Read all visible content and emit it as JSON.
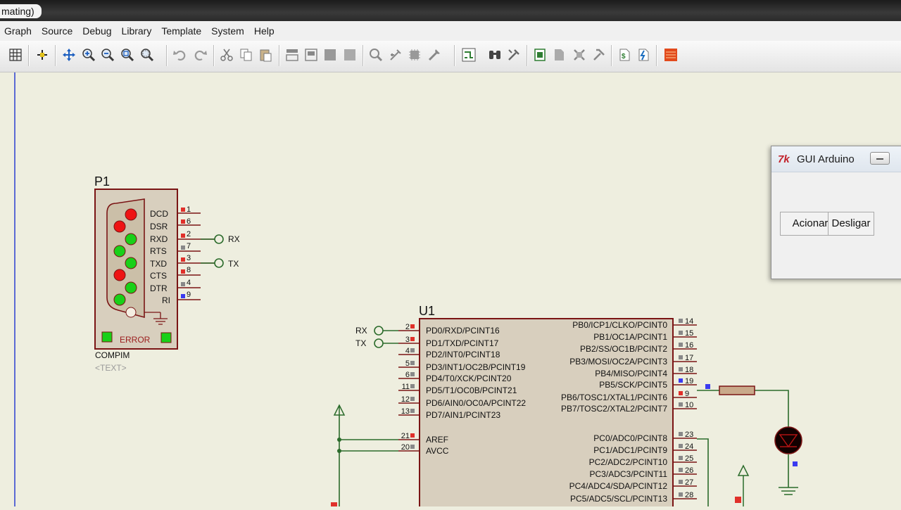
{
  "window": {
    "title_fragment": "mating)"
  },
  "menu": [
    "Graph",
    "Source",
    "Debug",
    "Library",
    "Template",
    "System",
    "Help"
  ],
  "toolbar_icons": [
    "grid-icon",
    "origin-icon",
    "pan-icon",
    "zoom-in-icon",
    "zoom-out-icon",
    "zoom-all-icon",
    "zoom-area-icon",
    "undo-icon",
    "redo-icon",
    "cut-icon",
    "copy-icon",
    "paste-icon",
    "block-copy-icon",
    "block-move-icon",
    "block-rotate-icon",
    "block-delete-icon",
    "pick-device-icon",
    "make-device-icon",
    "packaging-icon",
    "decompose-icon",
    "wire-autorouter-icon",
    "search-tag-icon",
    "property-assign-icon",
    "new-sheet-icon",
    "remove-sheet-icon",
    "exit-to-parent-icon",
    "goto-sheet-icon",
    "bill-of-materials-icon",
    "electrical-check-icon",
    "ares-icon"
  ],
  "compim": {
    "ref": "P1",
    "part": "COMPIM",
    "text_placeholder": "<TEXT>",
    "status": "ERROR",
    "signals": [
      "DCD",
      "DSR",
      "RXD",
      "RTS",
      "TXD",
      "CTS",
      "DTR",
      "RI"
    ],
    "pins": [
      "1",
      "6",
      "2",
      "7",
      "3",
      "8",
      "4",
      "9"
    ],
    "terminals": [
      "RX",
      "TX"
    ]
  },
  "mcu": {
    "ref": "U1",
    "left_pins": [
      {
        "num": "2",
        "name": "PD0/RXD/PCINT16"
      },
      {
        "num": "3",
        "name": "PD1/TXD/PCINT17"
      },
      {
        "num": "4",
        "name": "PD2/INT0/PCINT18"
      },
      {
        "num": "5",
        "name": "PD3/INT1/OC2B/PCINT19"
      },
      {
        "num": "6",
        "name": "PD4/T0/XCK/PCINT20"
      },
      {
        "num": "11",
        "name": "PD5/T1/OC0B/PCINT21"
      },
      {
        "num": "12",
        "name": "PD6/AIN0/OC0A/PCINT22"
      },
      {
        "num": "13",
        "name": "PD7/AIN1/PCINT23"
      },
      {
        "num": "21",
        "name": "AREF"
      },
      {
        "num": "20",
        "name": "AVCC"
      }
    ],
    "right_pins": [
      {
        "num": "14",
        "name": "PB0/ICP1/CLKO/PCINT0"
      },
      {
        "num": "15",
        "name": "PB1/OC1A/PCINT1"
      },
      {
        "num": "16",
        "name": "PB2/SS/OC1B/PCINT2"
      },
      {
        "num": "17",
        "name": "PB3/MOSI/OC2A/PCINT3"
      },
      {
        "num": "18",
        "name": "PB4/MISO/PCINT4"
      },
      {
        "num": "19",
        "name": "PB5/SCK/PCINT5"
      },
      {
        "num": "9",
        "name": "PB6/TOSC1/XTAL1/PCINT6"
      },
      {
        "num": "10",
        "name": "PB7/TOSC2/XTAL2/PCINT7"
      },
      {
        "num": "23",
        "name": "PC0/ADC0/PCINT8"
      },
      {
        "num": "24",
        "name": "PC1/ADC1/PCINT9"
      },
      {
        "num": "25",
        "name": "PC2/ADC2/PCINT10"
      },
      {
        "num": "26",
        "name": "PC3/ADC3/PCINT11"
      },
      {
        "num": "27",
        "name": "PC4/ADC4/SDA/PCINT12"
      },
      {
        "num": "28",
        "name": "PC5/ADC5/SCL/PCINT13"
      }
    ],
    "terminals": [
      "RX",
      "TX"
    ]
  },
  "gui_window": {
    "title": "GUI Arduino",
    "app_icon": "tk-icon",
    "buttons": [
      "Acionar",
      "Desligar"
    ]
  }
}
